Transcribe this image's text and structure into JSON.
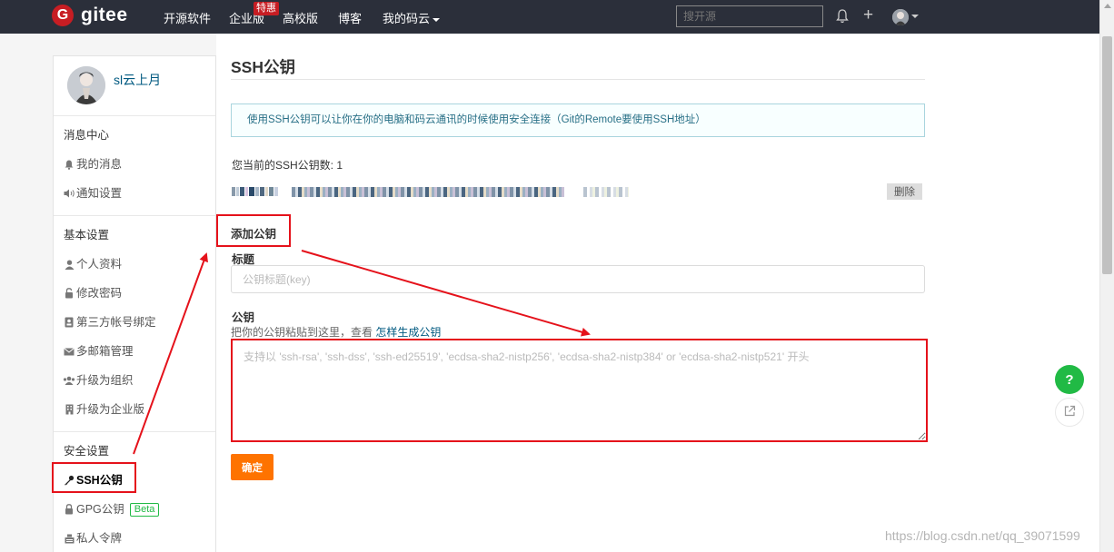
{
  "header": {
    "logo_mark": "G",
    "logo_text": "gitee",
    "nav": [
      {
        "label": "开源软件"
      },
      {
        "label": "企业版"
      },
      {
        "label": "高校版"
      },
      {
        "label": "博客"
      },
      {
        "label": "我的码云"
      }
    ],
    "hot_badge": "特惠",
    "search_placeholder": "搜开源",
    "plus_label": "+"
  },
  "sidebar": {
    "username": "sl云上月",
    "sections": [
      {
        "title": "消息中心",
        "items": [
          {
            "label": "我的消息",
            "icon": "bell-icon"
          },
          {
            "label": "通知设置",
            "icon": "volume-icon"
          }
        ]
      },
      {
        "title": "基本设置",
        "items": [
          {
            "label": "个人资料",
            "icon": "user-icon"
          },
          {
            "label": "修改密码",
            "icon": "unlock-icon"
          },
          {
            "label": "第三方帐号绑定",
            "icon": "id-card-icon"
          },
          {
            "label": "多邮箱管理",
            "icon": "mail-icon"
          },
          {
            "label": "升级为组织",
            "icon": "users-icon"
          },
          {
            "label": "升级为企业版",
            "icon": "building-icon"
          }
        ]
      },
      {
        "title": "安全设置",
        "items": [
          {
            "label": "SSH公钥",
            "icon": "key-icon",
            "active": true
          },
          {
            "label": "GPG公钥",
            "icon": "lock-icon",
            "badge": "Beta"
          },
          {
            "label": "私人令牌",
            "icon": "token-icon"
          }
        ]
      }
    ]
  },
  "main": {
    "title": "SSH公钥",
    "info": "使用SSH公钥可以让你在你的电脑和码云通讯的时候使用安全连接（Git的Remote要使用SSH地址）",
    "key_count_text": "您当前的SSH公钥数: 1",
    "delete_label": "删除",
    "add_key_title": "添加公钥",
    "title_label": "标题",
    "title_placeholder": "公钥标题(key)",
    "key_label": "公钥",
    "hint_text": "把你的公钥粘贴到这里，查看 ",
    "hint_link": "怎样生成公钥",
    "key_placeholder": "支持以 'ssh-rsa', 'ssh-dss', 'ssh-ed25519', 'ecdsa-sha2-nistp256', 'ecdsa-sha2-nistp384' or 'ecdsa-sha2-nistp521' 开头",
    "confirm_label": "确定"
  },
  "floating": {
    "help_label": "?"
  },
  "watermark": "https://blog.csdn.net/qq_39071599",
  "colors": {
    "topbar": "#2b2f3a",
    "brand_red": "#c71d23",
    "confirm_orange": "#fe7300",
    "annotation_red": "#e5121b",
    "help_green": "#21ba45",
    "link_blue": "#005980"
  }
}
